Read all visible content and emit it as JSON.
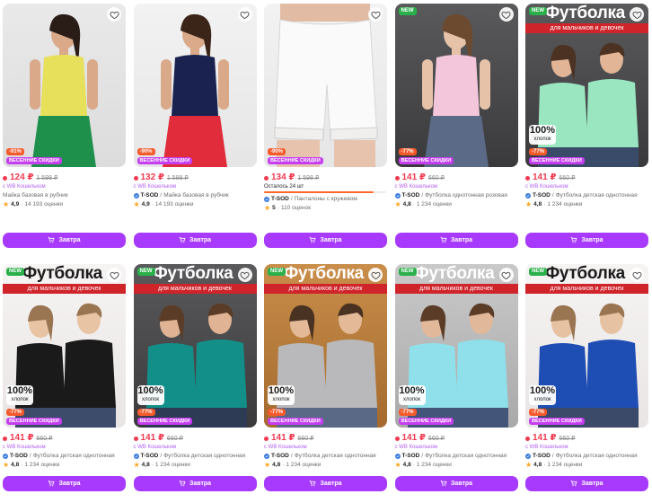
{
  "products": [
    {
      "price": "124 ₽",
      "old": "1 598 ₽",
      "seller": "с WB Кошельком",
      "brand": "",
      "title": "Майка базовая в рубчик",
      "rating": "4,9",
      "reviews": "14 193 оценки",
      "discount": "-91%",
      "spring": "ВЕСЕННИЕ СКИДКИ",
      "btn": "Завтра",
      "verified": false,
      "bg": "bg-gray",
      "art": "yellow"
    },
    {
      "price": "132 ₽",
      "old": "1 598 ₽",
      "seller": "с WB Кошельком",
      "brand": "T-SOD",
      "title": "Майка базовая в рубчик",
      "rating": "4,9",
      "reviews": "14 193 оценки",
      "discount": "-90%",
      "spring": "ВЕСЕННИЕ СКИДКИ",
      "btn": "Завтра",
      "verified": true,
      "bg": "bg-light",
      "art": "navy"
    },
    {
      "price": "134 ₽",
      "old": "1 598 ₽",
      "seller": "",
      "brand": "T-SOD",
      "title": "Панталоны с кружевом",
      "rating": "5",
      "reviews": "110 оценок",
      "discount": "-90%",
      "spring": "ВЕСЕННИЕ СКИДКИ",
      "btn": "Завтра",
      "verified": true,
      "bg": "bg-light",
      "art": "shorts",
      "left": "Осталось 24 шт",
      "left_fraction": 0.9
    },
    {
      "price": "141 ₽",
      "old": "660 ₽",
      "seller": "с WB Кошельком",
      "brand": "T-SOD",
      "title": "Футболка однотонная розовая",
      "rating": "4,8",
      "reviews": "1 234 оценки",
      "discount": "-77%",
      "spring": "ВЕСЕННИЕ СКИДКИ",
      "btn": "Завтра",
      "verified": true,
      "bg": "bg-dark",
      "art": "pink",
      "new": "NEW"
    },
    {
      "price": "141 ₽",
      "old": "660 ₽",
      "seller": "с WB Кошельком",
      "brand": "T-SOD",
      "title": "Футболка детская однотонная",
      "rating": "4,8",
      "reviews": "1 234 оценки",
      "discount": "-77%",
      "spring": "ВЕСЕННИЕ СКИДКИ",
      "btn": "Завтра",
      "verified": true,
      "bg": "bg-dark",
      "art": "mint",
      "new": "NEW",
      "banner": "Футболка",
      "banner_sub": "для мальчиков и девочек",
      "cotton": "100%",
      "cotton_sub": "хлопок"
    },
    {
      "price": "141 ₽",
      "old": "660 ₽",
      "seller": "с WB Кошельком",
      "brand": "T-SOD",
      "title": "Футболка детская однотонная",
      "rating": "4,8",
      "reviews": "1 234 оценки",
      "discount": "-77%",
      "spring": "ВЕСЕННИЕ СКИДКИ",
      "btn": "Завтра",
      "verified": true,
      "bg": "bg-pink",
      "art": "black",
      "new": "NEW",
      "banner": "Футболка",
      "banner_sub": "для мальчиков и девочек",
      "cotton": "100%",
      "cotton_sub": "хлопок"
    },
    {
      "price": "141 ₽",
      "old": "660 ₽",
      "seller": "с WB Кошельком",
      "brand": "T-SOD",
      "title": "Футболка детская однотонная",
      "rating": "4,8",
      "reviews": "1 234 оценки",
      "discount": "-77%",
      "spring": "ВЕСЕННИЕ СКИДКИ",
      "btn": "Завтра",
      "verified": true,
      "bg": "bg-dark",
      "art": "teal",
      "new": "NEW",
      "banner": "Футболка",
      "banner_sub": "для мальчиков и девочек",
      "cotton": "100%",
      "cotton_sub": "хлопок"
    },
    {
      "price": "141 ₽",
      "old": "660 ₽",
      "seller": "с WB Кошельком",
      "brand": "T-SOD",
      "title": "Футболка детская однотонная",
      "rating": "4,8",
      "reviews": "1 234 оценки",
      "discount": "-77%",
      "spring": "ВЕСЕННИЕ СКИДКИ",
      "btn": "Завтра",
      "verified": true,
      "bg": "bg-brown",
      "art": "gray",
      "new": "NEW",
      "banner": "Футболка",
      "banner_sub": "для мальчиков и девочек",
      "cotton": "100%",
      "cotton_sub": "хлопок"
    },
    {
      "price": "141 ₽",
      "old": "660 ₽",
      "seller": "с WB Кошельком",
      "brand": "T-SOD",
      "title": "Футболка детская однотонная",
      "rating": "4,8",
      "reviews": "1 234 оценки",
      "discount": "-77%",
      "spring": "ВЕСЕННИЕ СКИДКИ",
      "btn": "Завтра",
      "verified": true,
      "bg": "bg-lgray",
      "art": "sky",
      "new": "NEW",
      "banner": "Футболка",
      "banner_sub": "для мальчиков и девочек",
      "cotton": "100%",
      "cotton_sub": "хлопок"
    },
    {
      "price": "141 ₽",
      "old": "660 ₽",
      "seller": "с WB Кошельком",
      "brand": "T-SOD",
      "title": "Футболка детская однотонная",
      "rating": "4,8",
      "reviews": "1 234 оценки",
      "discount": "-77%",
      "spring": "ВЕСЕННИЕ СКИДКИ",
      "btn": "Завтра",
      "verified": true,
      "bg": "bg-pink",
      "art": "blue",
      "new": "NEW",
      "banner": "Футболка",
      "banner_sub": "для мальчиков и девочек",
      "cotton": "100%",
      "cotton_sub": "хлопок"
    }
  ],
  "colors": {
    "accent": "#a73afd",
    "price": "#f0394f",
    "spring": "#c53ef0",
    "discount": "#f55a2c",
    "new": "#2ab04a",
    "banner_red": "#d0242b"
  },
  "icons": {
    "favorite": "heart-icon",
    "cart": "cart-icon",
    "verified": "check-badge-icon",
    "star": "star-icon"
  }
}
